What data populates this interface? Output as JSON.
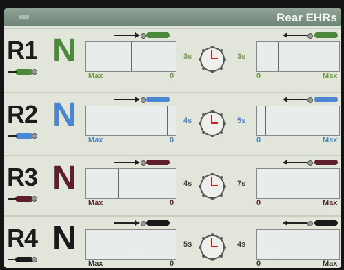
{
  "header": {
    "title": "Rear EHRs"
  },
  "rows": [
    {
      "id": "R1",
      "mode": "N",
      "color": "#4b8a3a",
      "label_color": "#6f9a3e",
      "left_max": "Max",
      "left_zero": "0",
      "left_time": "3s",
      "right_time": "3s",
      "right_zero": "0",
      "right_max": "Max",
      "left_fill": 0.5,
      "right_fill": 0.25
    },
    {
      "id": "R2",
      "mode": "N",
      "color": "#4a86d1",
      "label_color": "#4a86d1",
      "left_max": "Max",
      "left_zero": "0",
      "left_time": "4s",
      "right_time": "5s",
      "right_zero": "0",
      "right_max": "Max",
      "left_fill": 0.9,
      "right_fill": 0.1
    },
    {
      "id": "R3",
      "mode": "N",
      "color": "#5e1f2a",
      "label_color": "#5a2430",
      "left_max": "Max",
      "left_zero": "0",
      "left_time": "4s",
      "right_time": "7s",
      "right_zero": "0",
      "right_max": "Max",
      "left_fill": 0.35,
      "right_fill": 0.5
    },
    {
      "id": "R4",
      "mode": "N",
      "color": "#1a1a1a",
      "label_color": "#333333",
      "left_max": "Max",
      "left_zero": "0",
      "left_time": "5s",
      "right_time": "4s",
      "right_zero": "0",
      "right_max": "Max",
      "left_fill": 0.55,
      "right_fill": 0.2
    }
  ]
}
